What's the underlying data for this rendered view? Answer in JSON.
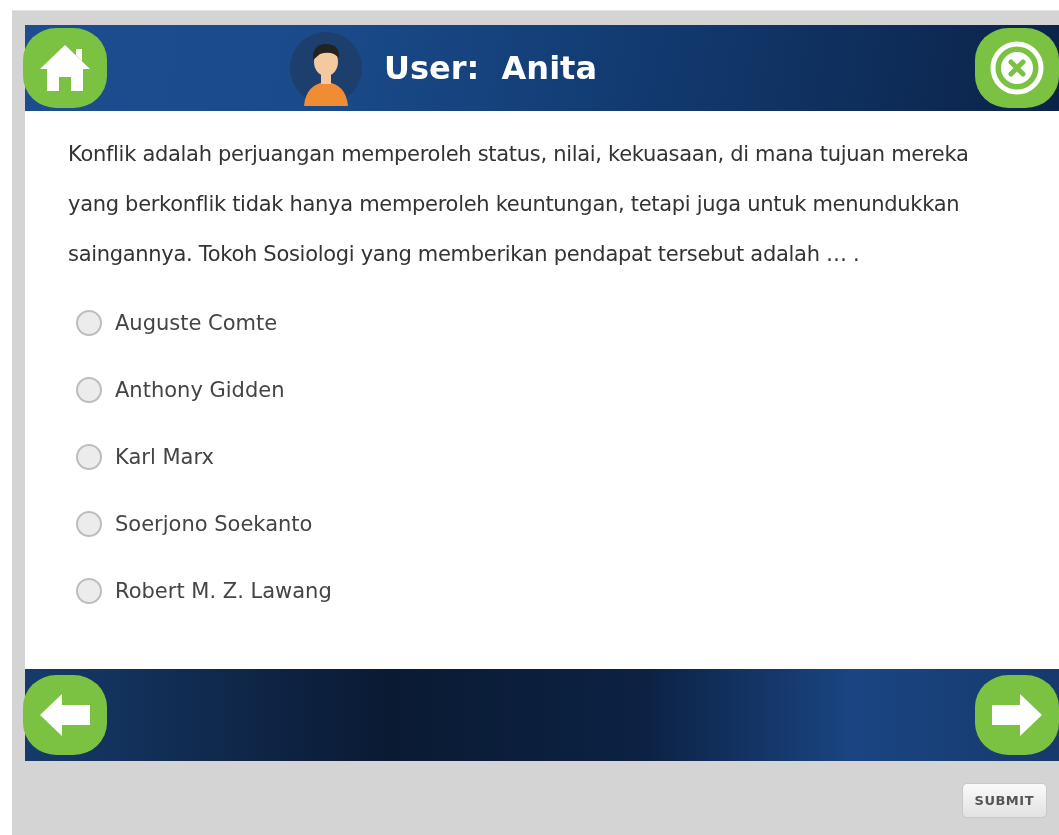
{
  "header": {
    "title": "User:  Anita"
  },
  "question": {
    "text": "Konflik adalah perjuangan memperoleh status, nilai, kekuasaan, di mana tujuan mereka yang berkonflik tidak hanya memperoleh keuntungan, tetapi juga untuk menundukkan saingannya. Tokoh Sosiologi yang memberikan pendapat tersebut adalah … ."
  },
  "options": [
    {
      "label": "Auguste Comte",
      "selected": false
    },
    {
      "label": "Anthony Gidden",
      "selected": false
    },
    {
      "label": "Karl Marx",
      "selected": false
    },
    {
      "label": "Soerjono Soekanto",
      "selected": false
    },
    {
      "label": "Robert M. Z. Lawang",
      "selected": false
    }
  ],
  "submit_button": {
    "label": "SUBMIT"
  }
}
